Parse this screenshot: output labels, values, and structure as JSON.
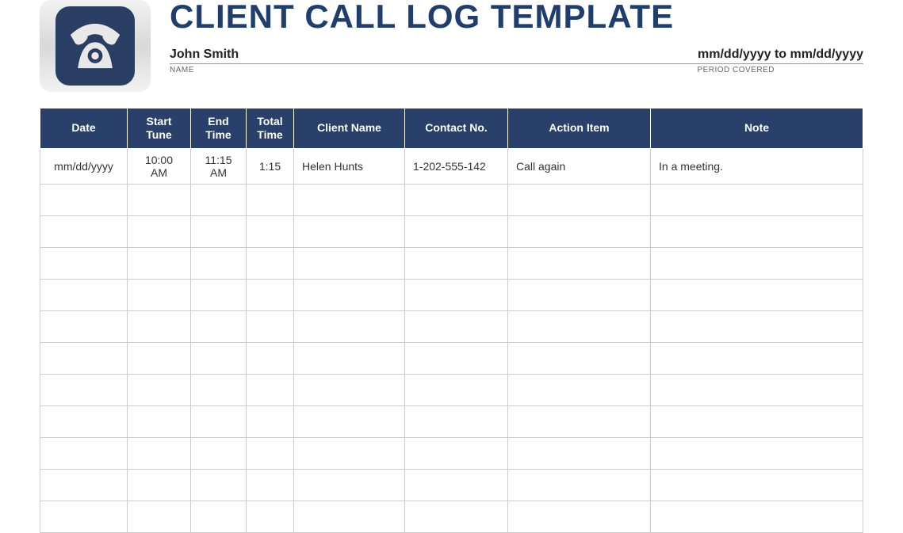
{
  "header": {
    "title": "CLIENT CALL LOG TEMPLATE",
    "name_value": "John Smith",
    "name_label": "NAME",
    "period_value": "mm/dd/yyyy to mm/dd/yyyy",
    "period_label": "PERIOD COVERED"
  },
  "table": {
    "columns": {
      "date": "Date",
      "start": "Start Tune",
      "end": "End Time",
      "total": "Total Time",
      "client": "Client Name",
      "contact": "Contact No.",
      "action": "Action Item",
      "note": "Note"
    },
    "rows": [
      {
        "date": "mm/dd/yyyy",
        "start": "10:00 AM",
        "end": "11:15 AM",
        "total": "1:15",
        "client": "Helen Hunts",
        "contact": "1-202-555-142",
        "action": "Call again",
        "note": "In a meeting."
      },
      {
        "date": "",
        "start": "",
        "end": "",
        "total": "",
        "client": "",
        "contact": "",
        "action": "",
        "note": ""
      },
      {
        "date": "",
        "start": "",
        "end": "",
        "total": "",
        "client": "",
        "contact": "",
        "action": "",
        "note": ""
      },
      {
        "date": "",
        "start": "",
        "end": "",
        "total": "",
        "client": "",
        "contact": "",
        "action": "",
        "note": ""
      },
      {
        "date": "",
        "start": "",
        "end": "",
        "total": "",
        "client": "",
        "contact": "",
        "action": "",
        "note": ""
      },
      {
        "date": "",
        "start": "",
        "end": "",
        "total": "",
        "client": "",
        "contact": "",
        "action": "",
        "note": ""
      },
      {
        "date": "",
        "start": "",
        "end": "",
        "total": "",
        "client": "",
        "contact": "",
        "action": "",
        "note": ""
      },
      {
        "date": "",
        "start": "",
        "end": "",
        "total": "",
        "client": "",
        "contact": "",
        "action": "",
        "note": ""
      },
      {
        "date": "",
        "start": "",
        "end": "",
        "total": "",
        "client": "",
        "contact": "",
        "action": "",
        "note": ""
      },
      {
        "date": "",
        "start": "",
        "end": "",
        "total": "",
        "client": "",
        "contact": "",
        "action": "",
        "note": ""
      },
      {
        "date": "",
        "start": "",
        "end": "",
        "total": "",
        "client": "",
        "contact": "",
        "action": "",
        "note": ""
      },
      {
        "date": "",
        "start": "",
        "end": "",
        "total": "",
        "client": "",
        "contact": "",
        "action": "",
        "note": ""
      }
    ]
  }
}
